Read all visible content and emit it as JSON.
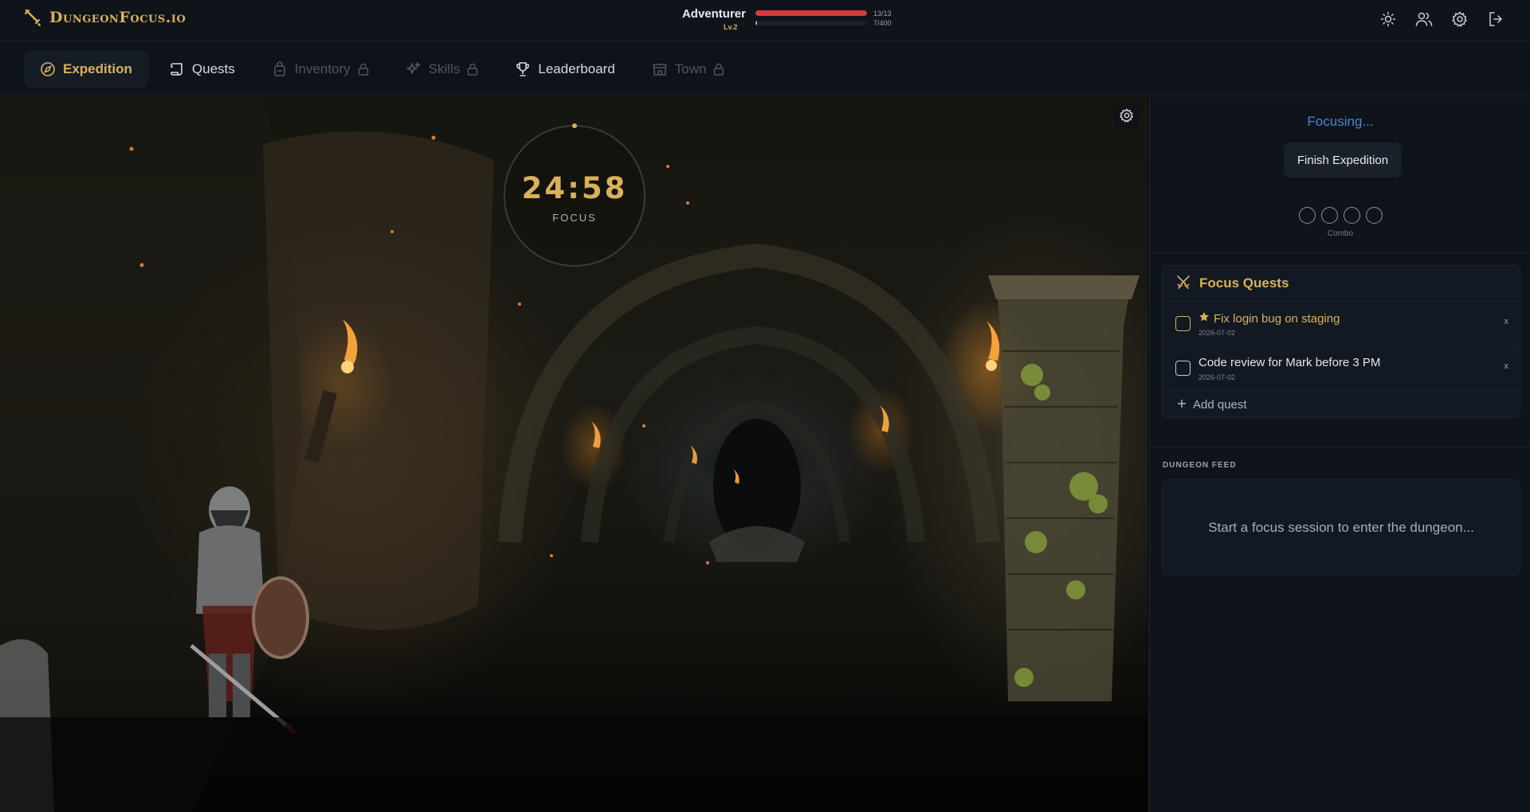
{
  "app": {
    "logo_text": "DungeonFocus.io"
  },
  "player": {
    "name": "Adventurer",
    "level": "Lv.2",
    "hp_text": "13/13",
    "hp_fraction": 1.0,
    "xp_text": "7/400",
    "xp_fraction": 0.0175
  },
  "header_actions": [
    "sun-icon",
    "users-icon",
    "gear-icon",
    "logout-icon"
  ],
  "nav": {
    "tabs": [
      {
        "label": "Expedition",
        "active": true,
        "locked": false
      },
      {
        "label": "Quests",
        "active": false,
        "locked": false
      },
      {
        "label": "Inventory",
        "active": false,
        "locked": true
      },
      {
        "label": "Skills",
        "active": false,
        "locked": true
      },
      {
        "label": "Leaderboard",
        "active": false,
        "locked": false
      },
      {
        "label": "Town",
        "active": false,
        "locked": true
      }
    ]
  },
  "timer": {
    "time": "24:58",
    "mode": "FOCUS"
  },
  "panel": {
    "status": "Focusing...",
    "finish_button": "Finish Expedition",
    "combo_label": "Combo",
    "combo_slots": 4,
    "combo_filled": 0
  },
  "quests": {
    "title": "Focus Quests",
    "items": [
      {
        "text": "Fix login bug on staging",
        "date": "2026-07-02",
        "priority": true,
        "remove": "x"
      },
      {
        "text": "Code review for Mark before 3 PM",
        "date": "2026-07-02",
        "priority": false,
        "remove": "x"
      }
    ],
    "add_label": "Add quest"
  },
  "feed": {
    "label": "DUNGEON FEED",
    "empty_text": "Start a focus session to enter the dungeon..."
  },
  "colors": {
    "accent_gold": "#d9b15a",
    "hp_red": "#d8393b",
    "status_blue": "#4b86c9",
    "background": "#0d1117"
  }
}
